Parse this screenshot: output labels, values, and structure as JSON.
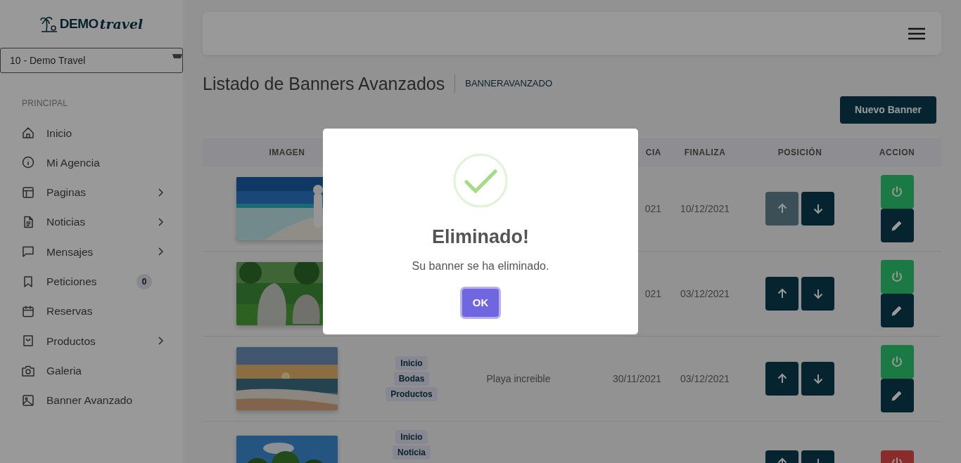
{
  "sidebar": {
    "logo": {
      "brand": "DEMO",
      "tagline": "travel"
    },
    "agency_select": {
      "value": "10 - Demo Travel"
    },
    "section": "PRINCIPAL",
    "items": [
      {
        "label": "Inicio",
        "has_submenu": false
      },
      {
        "label": "Mi Agencia",
        "has_submenu": false
      },
      {
        "label": "Paginas",
        "has_submenu": true
      },
      {
        "label": "Noticias",
        "has_submenu": true
      },
      {
        "label": "Mensajes",
        "has_submenu": true
      },
      {
        "label": "Peticiones",
        "has_submenu": false,
        "badge": "0"
      },
      {
        "label": "Reservas",
        "has_submenu": false
      },
      {
        "label": "Productos",
        "has_submenu": true
      },
      {
        "label": "Galeria",
        "has_submenu": false
      },
      {
        "label": "Banner Avanzado",
        "has_submenu": false
      }
    ]
  },
  "page": {
    "title": "Listado de Banners Avanzados",
    "breadcrumb": "BANNERAVANZADO",
    "new_button": "Nuevo Banner"
  },
  "table": {
    "columns": [
      "IMAGEN",
      "",
      "",
      "CIA",
      "FINALIZA",
      "POSICIÓN",
      "ACCION"
    ],
    "rows": [
      {
        "image": {
          "kind": "picture"
        },
        "tags": [],
        "starts": "021",
        "ends": "10/12/2021",
        "up_disabled": true,
        "active": true,
        "editable": true
      },
      {
        "image": {
          "kind": "picture"
        },
        "tags": [],
        "starts": "021",
        "ends": "03/12/2021",
        "up_disabled": false,
        "active": true,
        "editable": true
      },
      {
        "image": {
          "kind": "picture"
        },
        "tags": [
          "Inicio",
          "Bodas",
          "Productos"
        ],
        "description": "Playa increible",
        "starts": "30/11/2021",
        "ends": "03/12/2021",
        "up_disabled": false,
        "active": true,
        "editable": true
      },
      {
        "image": {
          "kind": "picture"
        },
        "tags": [
          "Inicio",
          "Noticia"
        ],
        "up_disabled": false,
        "active": false,
        "editable": false
      }
    ]
  },
  "dialog": {
    "kind": "success",
    "title": "Eliminado!",
    "message": "Su banner se ha eliminado.",
    "button": "OK"
  }
}
